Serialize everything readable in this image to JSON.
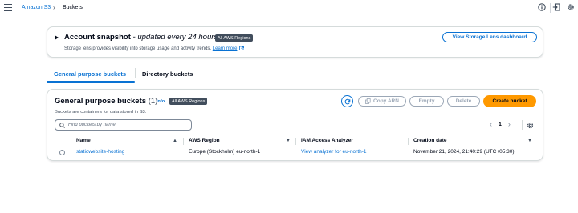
{
  "breadcrumb": {
    "service": "Amazon S3",
    "current": "Buckets"
  },
  "top_icons": [
    "info-icon",
    "export-icon",
    "settings-icon"
  ],
  "snapshot": {
    "title": "Account snapshot",
    "subtitle": "updated every 24 hours",
    "badge": "All AWS Regions",
    "description": "Storage lens provides visibility into storage usage and activity trends.",
    "learn_more": "Learn more",
    "button": "View Storage Lens dashboard"
  },
  "tabs": [
    {
      "label": "General purpose buckets",
      "active": true
    },
    {
      "label": "Directory buckets",
      "active": false
    }
  ],
  "buckets_panel": {
    "title": "General purpose buckets",
    "count": "(1)",
    "info": "Info",
    "badge": "All AWS Regions",
    "description": "Buckets are containers for data stored in S3.",
    "buttons": {
      "copy_arn": "Copy ARN",
      "empty": "Empty",
      "delete": "Delete",
      "create": "Create bucket"
    },
    "search_placeholder": "Find buckets by name",
    "pagination": {
      "page": "1",
      "prev": "‹",
      "next": "›"
    }
  },
  "table": {
    "columns": [
      "Name",
      "AWS Region",
      "IAM Access Analyzer",
      "Creation date"
    ],
    "rows": [
      {
        "name": "staticwebsite-hosting",
        "region": "Europe (Stockholm) eu-north-1",
        "analyzer": "View analyzer for eu-north-1",
        "created": "November 21, 2024, 21:40:29 (UTC+05:30)"
      }
    ]
  },
  "colors": {
    "link": "#0972d3",
    "primary_button": "#ff9900",
    "badge_bg": "#414d5c",
    "disabled": "#9ba7b6"
  }
}
